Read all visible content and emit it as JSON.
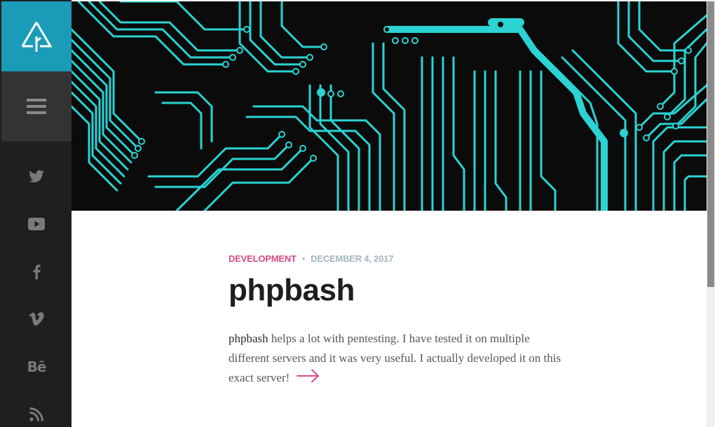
{
  "sidebar": {
    "logo_icon": "triangle-tree-logo",
    "menu_icon": "hamburger-icon",
    "social": [
      {
        "name": "twitter-icon"
      },
      {
        "name": "youtube-icon"
      },
      {
        "name": "facebook-icon"
      },
      {
        "name": "vimeo-icon"
      },
      {
        "name": "behance-icon",
        "text": "Bē"
      },
      {
        "name": "rss-icon"
      }
    ]
  },
  "hero": {
    "image": "circuit-board-image"
  },
  "post": {
    "category": "DEVELOPMENT",
    "separator": "•",
    "date": "DECEMBER 4, 2017",
    "title": "phpbash",
    "excerpt_lead": "phpbash",
    "excerpt_rest": " helps a lot with pentesting. I have tested it on multiple different servers and it was very useful. I actually developed it on this exact server!",
    "read_more_icon": "arrow-right-icon"
  },
  "colors": {
    "accent": "#1a9bb8",
    "category": "#d64b85",
    "date": "#a4b6bd",
    "circuit": "#2bd3d3",
    "sidebar": "#1f1f1f"
  }
}
